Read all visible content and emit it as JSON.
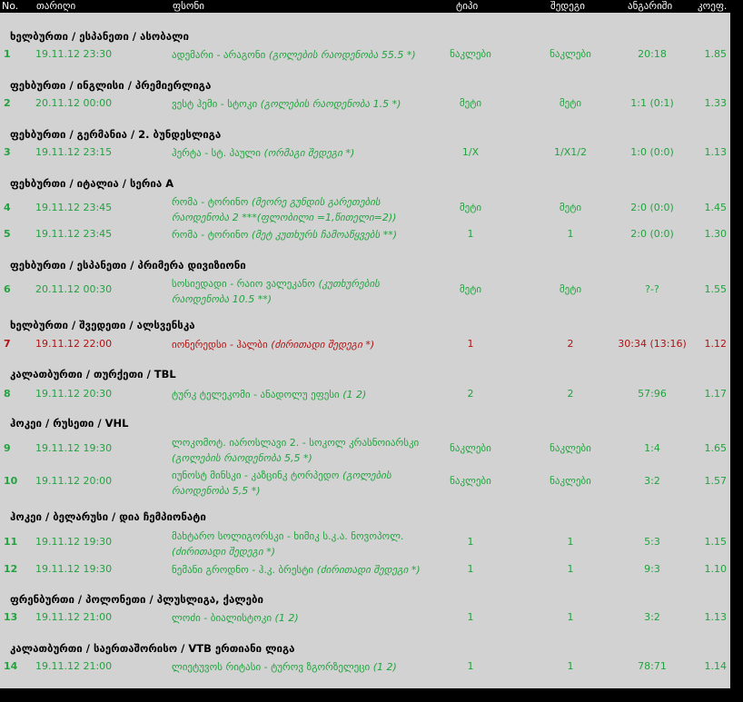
{
  "header": {
    "no": "No.",
    "date": "თარიღი",
    "event": "ფსონი",
    "type": "ტიპი",
    "result": "შედეგი",
    "score": "ანგარიში",
    "coef": "კოეფ."
  },
  "sections": [
    {
      "title": "ხელბურთი / ესპანეთი / ასობალი"
    },
    {
      "title": "ფეხბურთი / ინგლისი / პრემიერლიგა"
    },
    {
      "title": "ფეხბურთი / გერმანია / 2. ბუნდესლიგა"
    },
    {
      "title": "ფეხბურთი / იტალია / სერია A"
    },
    {
      "title": "ფეხბურთი / ესპანეთი / პრიმერა დივიზიონი"
    },
    {
      "title": "ხელბურთი / შვედეთი / ალსვენსკა"
    },
    {
      "title": "კალათბურთი / თურქეთი / TBL"
    },
    {
      "title": "ჰოკეი / რუსეთი / VHL"
    },
    {
      "title": "ჰოკეი / ბელარუსი / დია ჩემპიონატი"
    },
    {
      "title": "ფრენბურთი / პოლონეთი / პლუსლიგა, ქალები"
    },
    {
      "title": "კალათბურთი / საერთაშორისო / VTB ერთიანი ლიგა"
    }
  ],
  "rows": [
    {
      "no": "1",
      "date": "19.11.12 23:30",
      "teams": "ადემარი - არაგონი",
      "note": "(გოლების რაოდენობა 55.5 *)",
      "type": "ნაკლები",
      "result": "ნაკლები",
      "score": "20:18",
      "coef": "1.85"
    },
    {
      "no": "2",
      "date": "20.11.12 00:00",
      "teams": "ვესტ ჰემი - სტოკი",
      "note": "(გოლების რაოდენობა 1.5 *)",
      "type": "მეტი",
      "result": "მეტი",
      "score": "1:1 (0:1)",
      "coef": "1.33"
    },
    {
      "no": "3",
      "date": "19.11.12 23:15",
      "teams": "ჰერტა - სტ. პაული",
      "note": "(ორმაგი შედეგი *)",
      "type": "1/X",
      "result": "1/X1/2",
      "score": "1:0 (0:0)",
      "coef": "1.13"
    },
    {
      "no": "4",
      "date": "19.11.12 23:45",
      "teams": "რომა - ტორინო",
      "note": "(მეორე გუნდის გარეთების რაოდენობა 2 ***(ფლობილი =1,წითელი=2))",
      "type": "მეტი",
      "result": "მეტი",
      "score": "2:0 (0:0)",
      "coef": "1.45"
    },
    {
      "no": "5",
      "date": "19.11.12 23:45",
      "teams": "რომა - ტორინო",
      "note": "(მეტ კუთხურს ჩამოაწყვებს **)",
      "type": "1",
      "result": "1",
      "score": "2:0 (0:0)",
      "coef": "1.30"
    },
    {
      "no": "6",
      "date": "20.11.12 00:30",
      "teams": "სოსიედადი - რაიო ვალეკანო",
      "note": "(კუთხურების რაოდენობა 10.5 **)",
      "type": "მეტი",
      "result": "მეტი",
      "score": "?-?",
      "coef": "1.55"
    },
    {
      "no": "7",
      "date": "19.11.12 22:00",
      "teams": "იონერედსი - ჰალბი",
      "note": "(ძირითადი შედეგი *)",
      "type": "1",
      "result": "2",
      "score": "30:34 (13:16)",
      "coef": "1.12"
    },
    {
      "no": "8",
      "date": "19.11.12 20:30",
      "teams": "ტურკ ტელეკომი - ანადოლუ ეფესი",
      "note": "(1 2)",
      "type": "2",
      "result": "2",
      "score": "57:96",
      "coef": "1.17"
    },
    {
      "no": "9",
      "date": "19.11.12 19:30",
      "teams": "ლოკომოტ. იაროსლავი 2. - სოკოლ კრასნოიარსკი",
      "note": "(გოლების რაოდენობა 5,5 *)",
      "type": "ნაკლები",
      "result": "ნაკლები",
      "score": "1:4",
      "coef": "1.65"
    },
    {
      "no": "10",
      "date": "19.11.12 20:00",
      "teams": "იუნოსტ მინსკი - კაზცინკ ტორპედო",
      "note": "(გოლების რაოდენობა 5,5 *)",
      "type": "ნაკლები",
      "result": "ნაკლები",
      "score": "3:2",
      "coef": "1.57"
    },
    {
      "no": "11",
      "date": "19.11.12 19:30",
      "teams": "მახტარო სოლიგორსკი - ხიმიკ ს.კ.ა. ნოვოპოლ.",
      "note": "(ძირითადი შედეგი *)",
      "type": "1",
      "result": "1",
      "score": "5:3",
      "coef": "1.15"
    },
    {
      "no": "12",
      "date": "19.11.12 19:30",
      "teams": "ნემანი გროდნო - ჰ.კ. ბრესტი",
      "note": "(ძირითადი შედეგი *)",
      "type": "1",
      "result": "1",
      "score": "9:3",
      "coef": "1.10"
    },
    {
      "no": "13",
      "date": "19.11.12 21:00",
      "teams": "ლოძი - ბიალისტოკი",
      "note": "(1 2)",
      "type": "1",
      "result": "1",
      "score": "3:2",
      "coef": "1.13"
    },
    {
      "no": "14",
      "date": "19.11.12 21:00",
      "teams": "ლიეტუვოს რიტასი - ტუროვ ზგორზელეცი",
      "note": "(1 2)",
      "type": "1",
      "result": "1",
      "score": "78:71",
      "coef": "1.14"
    }
  ]
}
